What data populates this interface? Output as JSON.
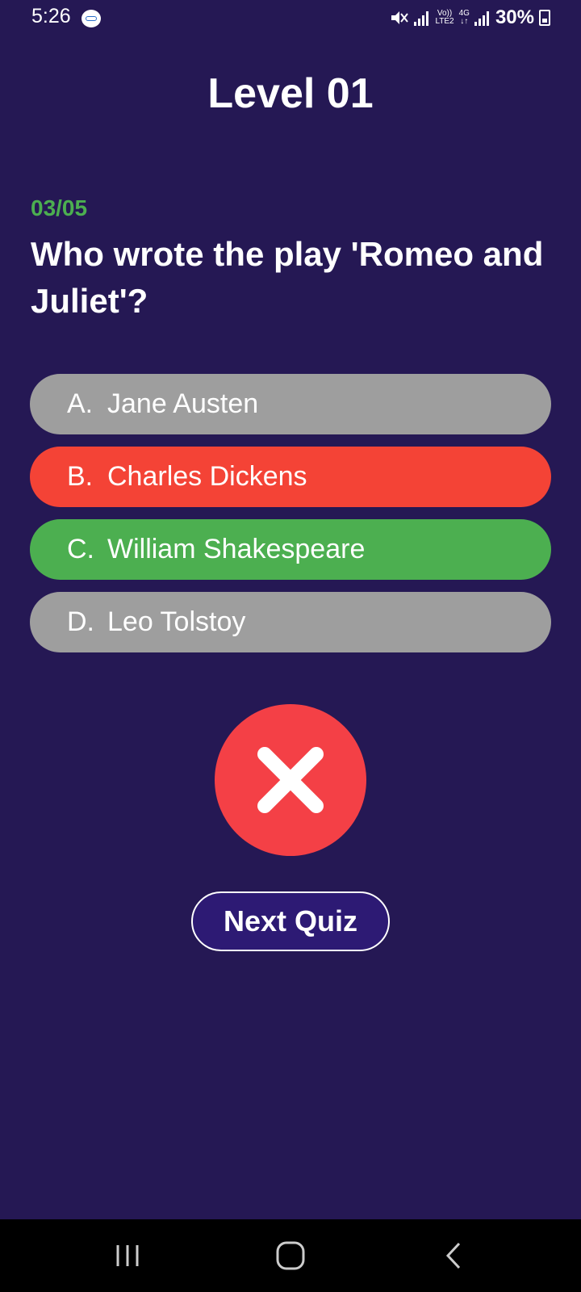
{
  "status_bar": {
    "time": "5:26",
    "network_volte": "Vo))",
    "network_lte": "LTE2",
    "network_4g": "4G",
    "battery": "30%",
    "icons": [
      "app-notification-icon",
      "mute-icon",
      "signal-icon",
      "signal-icon",
      "battery-icon"
    ]
  },
  "quiz": {
    "level_title": "Level 01",
    "progress": "03/05",
    "question": "Who wrote the play 'Romeo and Juliet'?",
    "options": [
      {
        "letter": "A.",
        "text": "Jane Austen",
        "state": "neutral",
        "color": "#9e9e9e"
      },
      {
        "letter": "B.",
        "text": "Charles Dickens",
        "state": "wrong-selected",
        "color": "#f44336"
      },
      {
        "letter": "C.",
        "text": "William Shakespeare",
        "state": "correct",
        "color": "#4caf50"
      },
      {
        "letter": "D.",
        "text": "Leo Tolstoy",
        "state": "neutral",
        "color": "#9e9e9e"
      }
    ],
    "result_icon": "close-icon",
    "result_color": "#f44046",
    "next_button_label": "Next Quiz"
  },
  "nav_bar": {
    "icons": [
      "recent-apps-icon",
      "home-icon",
      "back-icon"
    ]
  },
  "colors": {
    "background": "#251854",
    "progress_green": "#4caf50",
    "next_button_bg": "#2d1a74"
  }
}
